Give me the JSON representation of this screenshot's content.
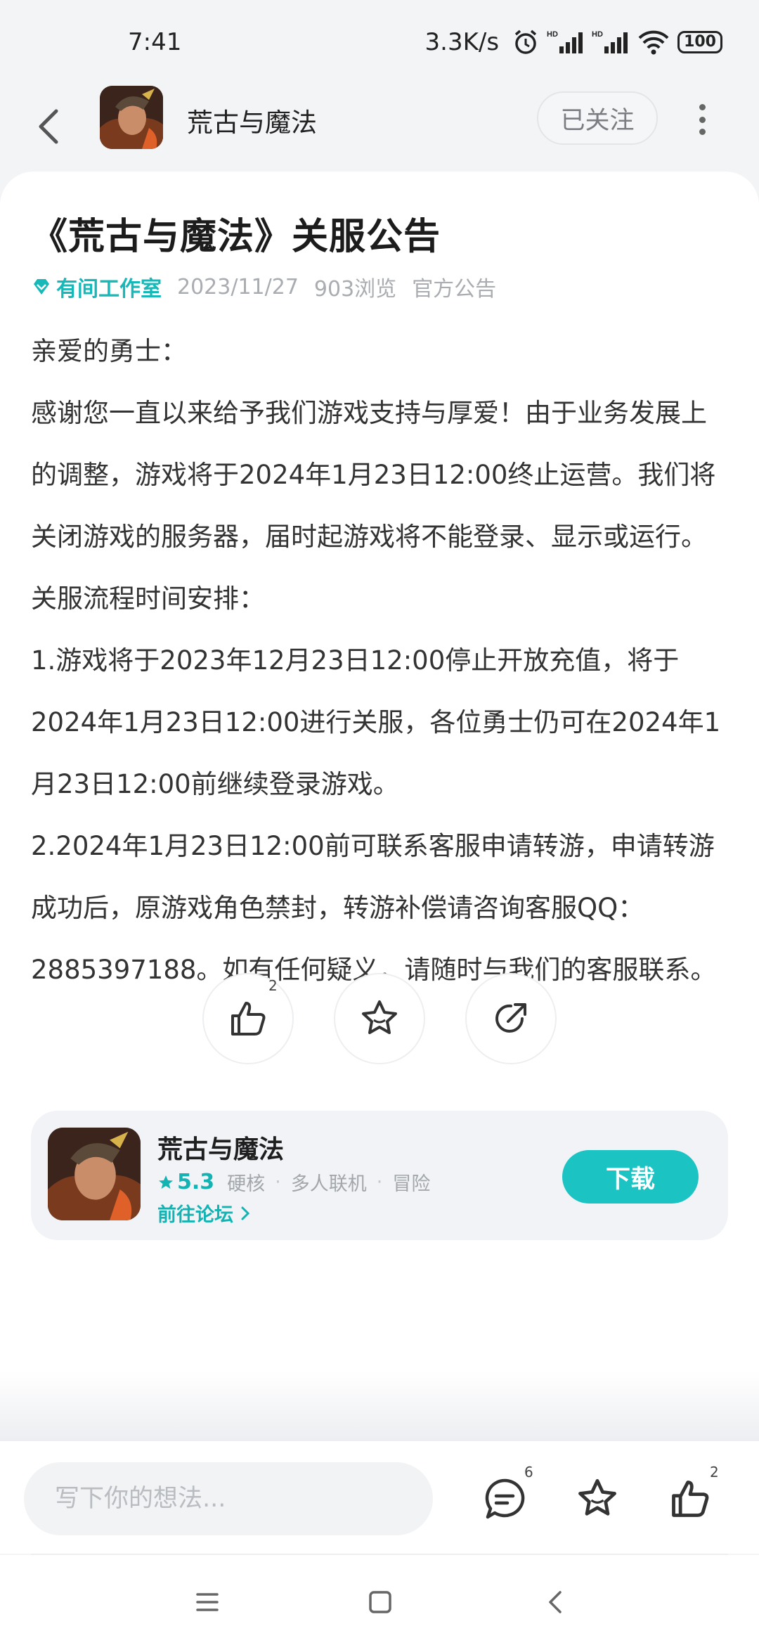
{
  "status_bar": {
    "time": "7:41",
    "net_speed": "3.3K/s",
    "battery": "100",
    "icons": [
      "alarm-icon",
      "hd-signal-icon",
      "hd-signal-icon",
      "wifi-icon",
      "battery-icon"
    ]
  },
  "nav": {
    "title": "荒古与魔法",
    "follow_label": "已关注",
    "icons": [
      "back-arrow-icon",
      "more-vertical-icon"
    ]
  },
  "article": {
    "title": "《荒古与魔法》关服公告",
    "author": "有间工作室",
    "date": "2023/11/27",
    "views": "903浏览",
    "category": "官方公告",
    "paragraphs": [
      "亲爱的勇士：",
      "感谢您一直以来给予我们游戏支持与厚爱！由于业务发展上的调整，游戏将于2024年1月23日12:00终止运营。我们将关闭游戏的服务器，届时起游戏将不能登录、显示或运行。",
      "关服流程时间安排：",
      "1.游戏将于2023年12月23日12:00停止开放充值，将于2024年1月23日12:00进行关服，各位勇士仍可在2024年1月23日12:00前继续登录游戏。",
      "2.2024年1月23日12:00前可联系客服申请转游，申请转游成功后，原游戏角色禁封，转游补偿请咨询客服QQ：2885397188。如有任何疑义，请随时与我们的客服联系。"
    ]
  },
  "actions": {
    "like_count": "2",
    "icons": [
      "thumbs-up-icon",
      "star-icon",
      "share-icon"
    ]
  },
  "app_card": {
    "name": "荒古与魔法",
    "rating": "5.3",
    "tags": [
      "硬核",
      "多人联机",
      "冒险"
    ],
    "forum_label": "前往论坛",
    "download_label": "下载",
    "accent_color": "#1bc3c3"
  },
  "bottom_bar": {
    "input_placeholder": "写下你的想法...",
    "comment_count": "6",
    "like_count": "2",
    "icons": [
      "comment-icon",
      "star-icon",
      "thumbs-up-icon"
    ]
  },
  "system_nav": {
    "icons": [
      "menu-icon",
      "home-icon",
      "back-icon"
    ]
  }
}
